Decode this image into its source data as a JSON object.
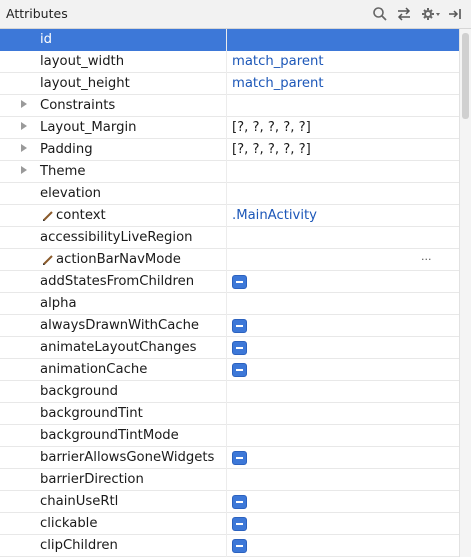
{
  "header": {
    "title": "Attributes",
    "tools": [
      {
        "name": "search-icon"
      },
      {
        "name": "swap-arrows-icon"
      },
      {
        "name": "gear-icon"
      },
      {
        "name": "pin-icon"
      }
    ]
  },
  "rows": [
    {
      "name": "id",
      "selected": true
    },
    {
      "name": "layout_width",
      "value": "match_parent",
      "value_style": "link"
    },
    {
      "name": "layout_height",
      "value": "match_parent",
      "value_style": "link"
    },
    {
      "name": "Constraints",
      "expandable": true
    },
    {
      "name": "Layout_Margin",
      "expandable": true,
      "value": "[?, ?, ?, ?, ?]",
      "value_style": "plain"
    },
    {
      "name": "Padding",
      "expandable": true,
      "value": "[?, ?, ?, ?, ?]",
      "value_style": "plain"
    },
    {
      "name": "Theme",
      "expandable": true
    },
    {
      "name": "elevation"
    },
    {
      "name": "context",
      "pencil": true,
      "value": ".MainActivity",
      "value_style": "link"
    },
    {
      "name": "accessibilityLiveRegion"
    },
    {
      "name": "actionBarNavMode",
      "pencil": true,
      "ellipsis": "..."
    },
    {
      "name": "addStatesFromChildren",
      "checkbox": true
    },
    {
      "name": "alpha"
    },
    {
      "name": "alwaysDrawnWithCache",
      "checkbox": true
    },
    {
      "name": "animateLayoutChanges",
      "checkbox": true
    },
    {
      "name": "animationCache",
      "checkbox": true
    },
    {
      "name": "background"
    },
    {
      "name": "backgroundTint"
    },
    {
      "name": "backgroundTintMode"
    },
    {
      "name": "barrierAllowsGoneWidgets",
      "checkbox": true
    },
    {
      "name": "barrierDirection"
    },
    {
      "name": "chainUseRtl",
      "checkbox": true
    },
    {
      "name": "clickable",
      "checkbox": true
    },
    {
      "name": "clipChildren",
      "checkbox": true
    }
  ],
  "colors": {
    "selection": "#3d78d8",
    "link": "#1c57b8",
    "checkbox": "#3d78d8"
  }
}
